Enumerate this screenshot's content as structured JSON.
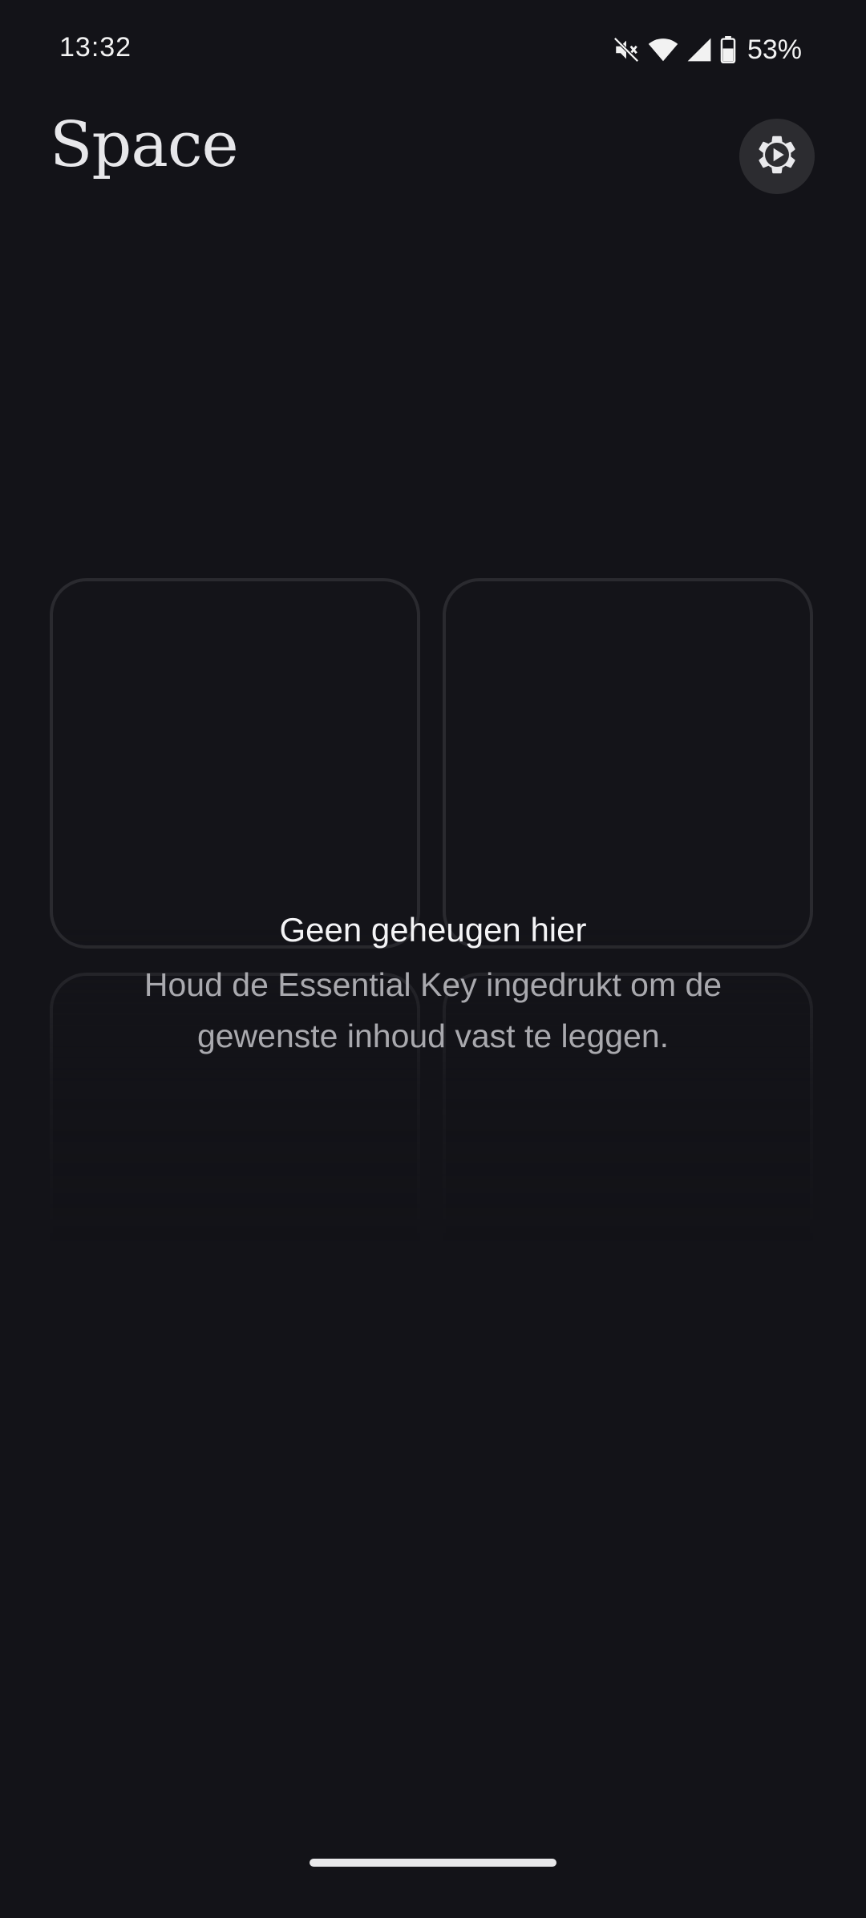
{
  "status_bar": {
    "time": "13:32",
    "battery_percent": "53%",
    "icons": [
      "mute-icon",
      "wifi-icon",
      "signal-icon",
      "battery-icon"
    ]
  },
  "header": {
    "title": "Space",
    "settings_icon": "gear-icon"
  },
  "empty_state": {
    "title": "Geen geheugen hier",
    "description": "Houd de Essential Key ingedrukt om de gewenste inhoud vast te leggen."
  },
  "colors": {
    "background": "#131318",
    "tile_border": "#2a2a2f",
    "settings_button_bg": "#2c2c30",
    "text_primary": "#f4f4f6",
    "text_secondary": "#a9a9ae"
  }
}
